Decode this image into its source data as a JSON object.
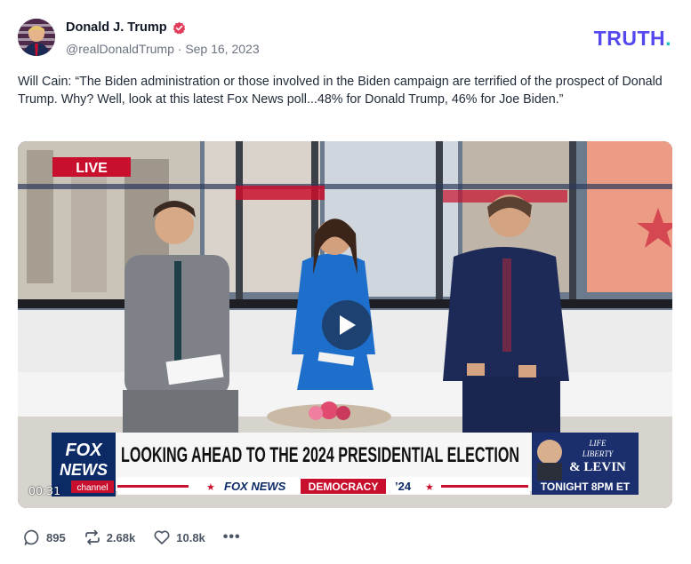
{
  "post": {
    "author_name": "Donald J. Trump",
    "handle": "@realDonaldTrump",
    "date": "Sep 16, 2023",
    "text": "Will Cain: “The Biden administration or those involved in the Biden campaign are terrified of the prospect of Donald Trump. Why? Well, look at this latest Fox News poll...48% for Donald Trump, 46% for Joe Biden.”"
  },
  "brand": {
    "name": "TRUTH",
    "dot": "."
  },
  "video": {
    "timecode": "00:31",
    "live_label": "LIVE",
    "headline": "LOOKING AHEAD TO THE 2024 PRESIDENTIAL ELECTION",
    "network_logo_top": "FOX",
    "network_logo_bottom": "NEWS",
    "network_logo_sub": "channel",
    "ticker_brand": "FOX NEWS",
    "ticker_segment": "DEMOCRACY",
    "ticker_year": "’24",
    "promo_line1": "LIFE",
    "promo_line2": "LIBERTY",
    "promo_line3": "& LEVIN",
    "promo_time": "TONIGHT 8PM ET"
  },
  "actions": {
    "replies": "895",
    "retruths": "2.68k",
    "likes": "10.8k",
    "more": "•••"
  },
  "colors": {
    "brand_purple": "#5448ee",
    "brand_teal": "#19c3c3",
    "fox_red": "#c8102e",
    "fox_blue": "#0b2a66"
  }
}
